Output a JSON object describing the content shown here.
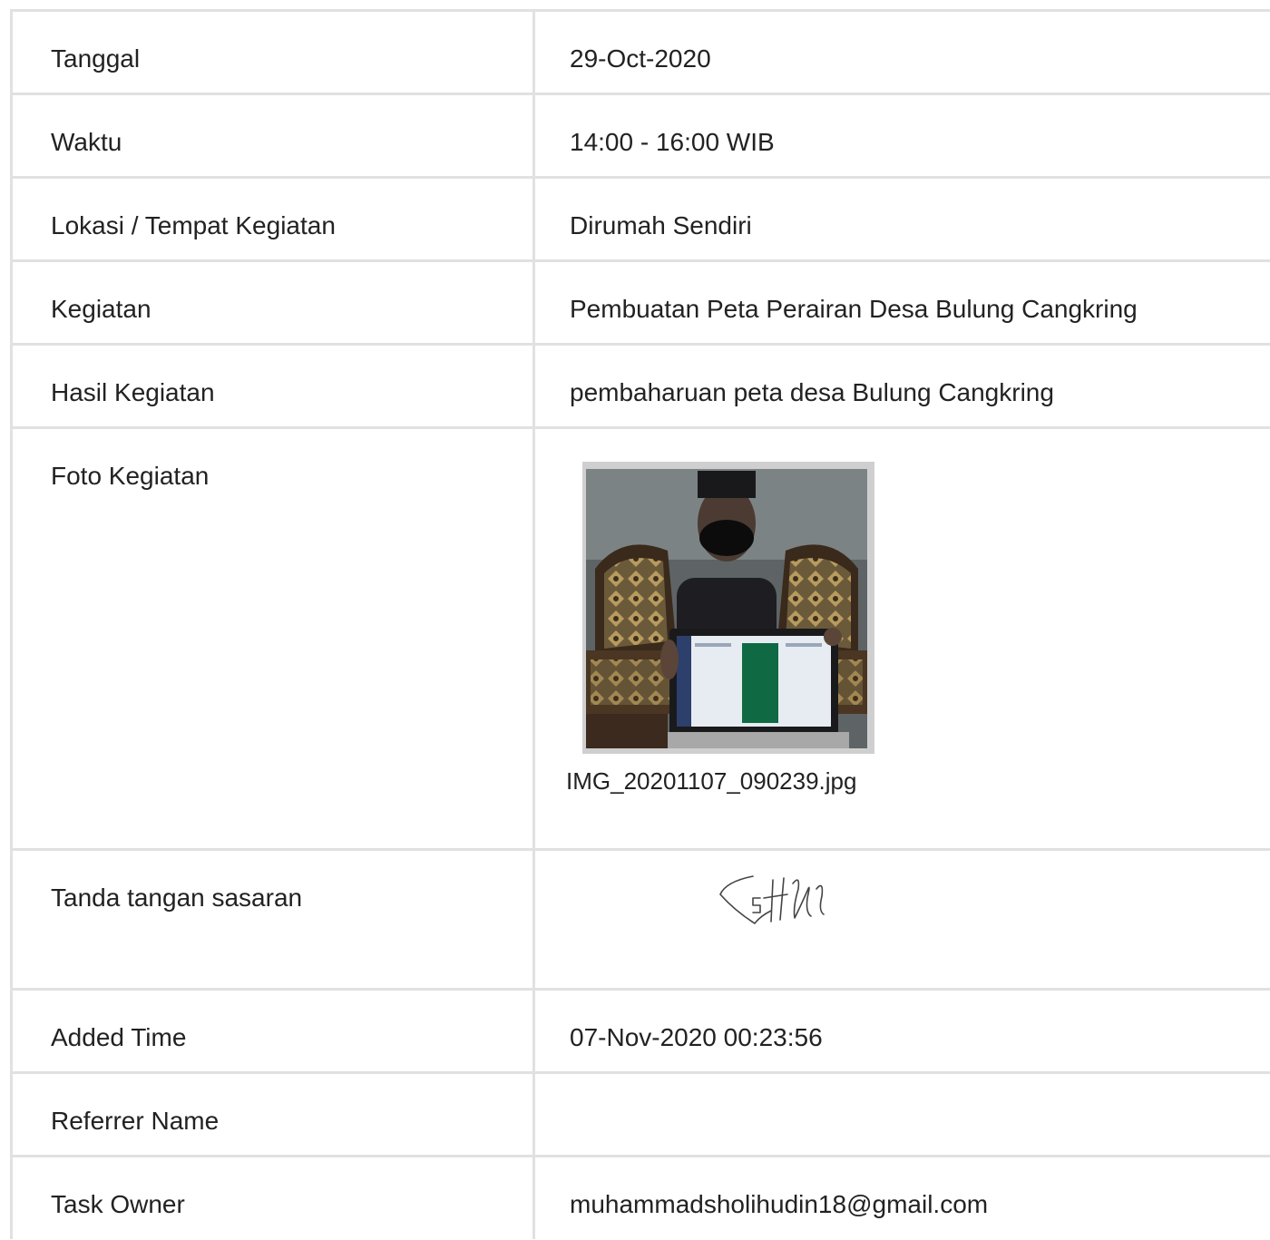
{
  "rows": [
    {
      "label": "Tanggal",
      "value": "29-Oct-2020"
    },
    {
      "label": "Waktu",
      "value": "14:00 - 16:00 WIB"
    },
    {
      "label": "Lokasi / Tempat Kegiatan",
      "value": "Dirumah Sendiri"
    },
    {
      "label": "Kegiatan",
      "value": "Pembuatan Peta Perairan Desa Bulung Cangkring"
    },
    {
      "label": "Hasil Kegiatan",
      "value": "pembaharuan peta desa Bulung Cangkring"
    },
    {
      "label": "Foto Kegiatan",
      "caption": "IMG_20201107_090239.jpg"
    },
    {
      "label": "Tanda tangan sasaran"
    },
    {
      "label": "Added Time",
      "value": "07-Nov-2020 00:23:56"
    },
    {
      "label": "Referrer Name",
      "value": ""
    },
    {
      "label": "Task Owner",
      "value": "muhammadsholihudin18@gmail.com"
    }
  ]
}
